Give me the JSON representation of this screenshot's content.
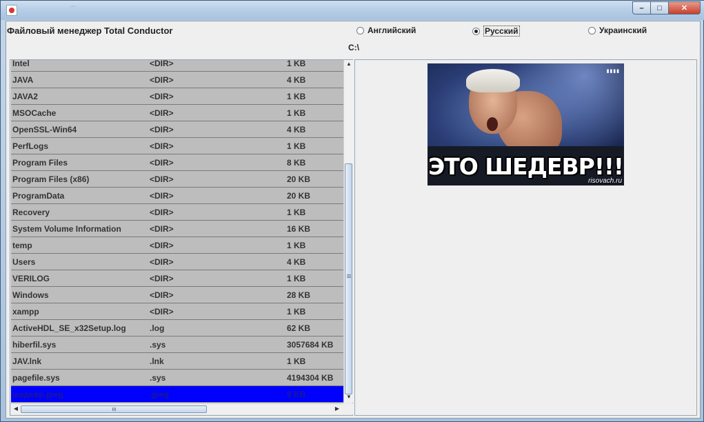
{
  "window": {
    "background_text": "...",
    "controls": {
      "minimize": "–",
      "maximize": "□",
      "close": "✕"
    }
  },
  "app": {
    "title": "Файловый менеджер Total Conductor",
    "languages": [
      {
        "label": "Английский",
        "selected": false
      },
      {
        "label": "Русский",
        "selected": true
      },
      {
        "label": "Украинский",
        "selected": false
      }
    ],
    "current_path": "C:\\"
  },
  "files": [
    {
      "name": "Intel",
      "type": "<DIR>",
      "size": "1 KB"
    },
    {
      "name": "JAVA",
      "type": "<DIR>",
      "size": "4 KB"
    },
    {
      "name": "JAVA2",
      "type": "<DIR>",
      "size": "1 KB"
    },
    {
      "name": "MSOCache",
      "type": "<DIR>",
      "size": "1 KB"
    },
    {
      "name": "OpenSSL-Win64",
      "type": "<DIR>",
      "size": "4 KB"
    },
    {
      "name": "PerfLogs",
      "type": "<DIR>",
      "size": "1 KB"
    },
    {
      "name": "Program Files",
      "type": "<DIR>",
      "size": "8 KB"
    },
    {
      "name": "Program Files (x86)",
      "type": "<DIR>",
      "size": "20 KB"
    },
    {
      "name": "ProgramData",
      "type": "<DIR>",
      "size": "20 KB"
    },
    {
      "name": "Recovery",
      "type": "<DIR>",
      "size": "1 KB"
    },
    {
      "name": "System Volume Information",
      "type": "<DIR>",
      "size": "16 KB"
    },
    {
      "name": "temp",
      "type": "<DIR>",
      "size": "1 KB"
    },
    {
      "name": "Users",
      "type": "<DIR>",
      "size": "4 KB"
    },
    {
      "name": "VERILOG",
      "type": "<DIR>",
      "size": "1 KB"
    },
    {
      "name": "Windows",
      "type": "<DIR>",
      "size": "28 KB"
    },
    {
      "name": "xampp",
      "type": "<DIR>",
      "size": "1 KB"
    },
    {
      "name": "ActiveHDL_SE_x32Setup.log",
      "type": ".log",
      "size": "62 KB"
    },
    {
      "name": "hiberfil.sys",
      "type": ".sys",
      "size": "3057684 KB"
    },
    {
      "name": "JAV.lnk",
      "type": ".lnk",
      "size": "1 KB"
    },
    {
      "name": "pagefile.sys",
      "type": ".sys",
      "size": "4194304 KB"
    },
    {
      "name": "шедевр.jpeg",
      "type": ".jpeg",
      "size": "9 KB",
      "selected": true
    }
  ],
  "preview": {
    "caption": "ЭТО ШЕДЕВР!!!",
    "watermark": "risovach.ru"
  },
  "colors": {
    "row_background": "#bdbdbd",
    "selection": "#0000ff",
    "close_button": "#c7402c"
  }
}
